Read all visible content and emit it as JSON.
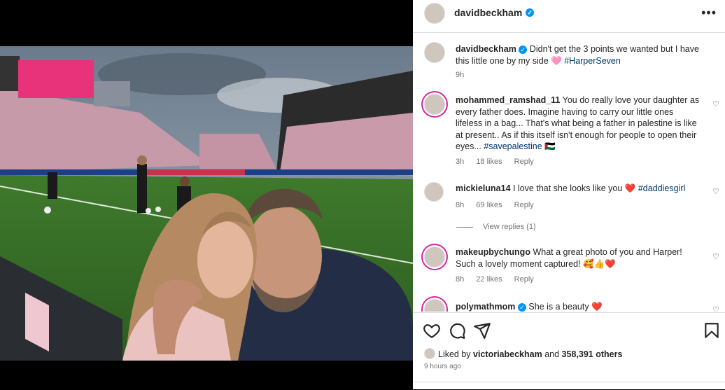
{
  "post": {
    "author": "davidbeckham",
    "caption": "Didn't get the 3 points we wanted but I have this little one by my side 🩷",
    "caption_tag": "#HarperSeven",
    "caption_time": "9h"
  },
  "comments": [
    {
      "user": "mohammed_ramshad_11",
      "text": "You do really love your daughter as every father does. Imagine having to carry our little ones lifeless in a bag... That's what being a father in palestine is like at present.. As if this itself isn't enough for people to open their eyes...",
      "tag": "#savepalestine",
      "suffix": "🇵🇸",
      "time": "3h",
      "likes": "18 likes",
      "reply": "Reply"
    },
    {
      "user": "mickieluna14",
      "text": "I love that she looks like you ❤️",
      "tag": "#daddiesgirl",
      "time": "8h",
      "likes": "69 likes",
      "reply": "Reply",
      "view_replies": "View replies (1)"
    },
    {
      "user": "makeupbychungo",
      "text": "What a great photo of you and Harper! Such a lovely moment captured! 🥰👍❤️",
      "time": "8h",
      "likes": "22 likes",
      "reply": "Reply"
    },
    {
      "user": "polymathmom",
      "text": "She is a beauty ❤️"
    }
  ],
  "likes": {
    "prefix": "Liked by",
    "user": "victoriabeckham",
    "middle": "and",
    "count": "358,391 others"
  },
  "posted_ago": "9 hours ago",
  "colors": {
    "verified": "#0095f6",
    "hashtag": "#00376b",
    "scoreboard": "#e8337a"
  },
  "icons": [
    "more-options-icon",
    "heart-icon",
    "comment-icon",
    "share-icon",
    "bookmark-icon",
    "verified-icon"
  ]
}
